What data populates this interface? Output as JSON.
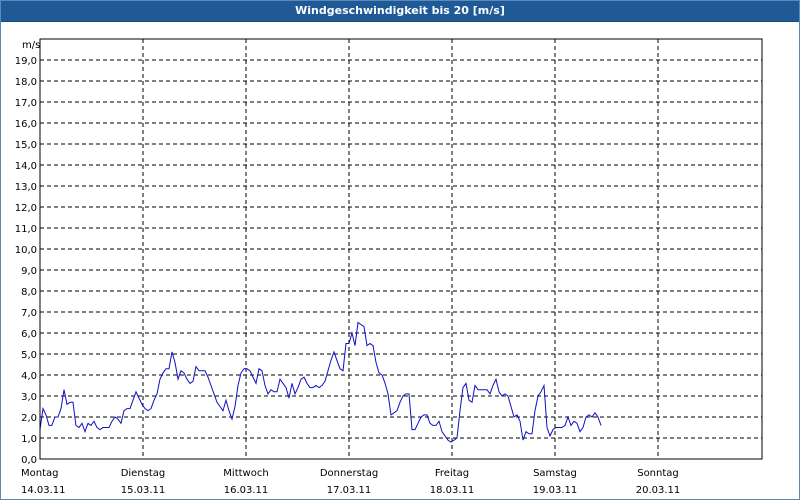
{
  "window": {
    "title": "Windgeschwindigkeit bis 20 [m/s]"
  },
  "chart_data": {
    "type": "line",
    "title": "Windgeschwindigkeit bis 20 [m/s]",
    "ylabel": "m/s",
    "xlabel": "",
    "ylim": [
      0,
      20
    ],
    "y_ticks": [
      "0,0",
      "1,0",
      "2,0",
      "3,0",
      "4,0",
      "5,0",
      "6,0",
      "7,0",
      "8,0",
      "9,0",
      "10,0",
      "11,0",
      "12,0",
      "13,0",
      "14,0",
      "15,0",
      "16,0",
      "17,0",
      "18,0",
      "19,0"
    ],
    "x_labels": [
      {
        "day": "Montag",
        "date": "14.03.11"
      },
      {
        "day": "Dienstag",
        "date": "15.03.11"
      },
      {
        "day": "Mittwoch",
        "date": "16.03.11"
      },
      {
        "day": "Donnerstag",
        "date": "17.03.11"
      },
      {
        "day": "Freitag",
        "date": "18.03.11"
      },
      {
        "day": "Samstag",
        "date": "19.03.11"
      },
      {
        "day": "Sonntag",
        "date": "20.03.11"
      }
    ],
    "xlim_days": [
      0,
      7
    ],
    "grid": true,
    "line_color": "#1010c0",
    "series": [
      {
        "values": [
          [
            0.0,
            1.4
          ],
          [
            0.029,
            2.4
          ],
          [
            0.058,
            2.1
          ],
          [
            0.087,
            1.6
          ],
          [
            0.116,
            1.6
          ],
          [
            0.145,
            2.0
          ],
          [
            0.175,
            2.0
          ],
          [
            0.204,
            2.4
          ],
          [
            0.233,
            3.3
          ],
          [
            0.262,
            2.6
          ],
          [
            0.291,
            2.7
          ],
          [
            0.32,
            2.7
          ],
          [
            0.349,
            1.6
          ],
          [
            0.379,
            1.5
          ],
          [
            0.408,
            1.7
          ],
          [
            0.437,
            1.3
          ],
          [
            0.466,
            1.7
          ],
          [
            0.495,
            1.6
          ],
          [
            0.524,
            1.8
          ],
          [
            0.553,
            1.5
          ],
          [
            0.583,
            1.4
          ],
          [
            0.612,
            1.5
          ],
          [
            0.641,
            1.5
          ],
          [
            0.67,
            1.5
          ],
          [
            0.699,
            1.8
          ],
          [
            0.728,
            2.0
          ],
          [
            0.757,
            1.9
          ],
          [
            0.786,
            1.7
          ],
          [
            0.816,
            2.3
          ],
          [
            0.845,
            2.4
          ],
          [
            0.874,
            2.4
          ],
          [
            0.903,
            2.8
          ],
          [
            0.932,
            3.2
          ],
          [
            0.961,
            2.9
          ],
          [
            0.99,
            2.6
          ],
          [
            1.019,
            2.4
          ],
          [
            1.049,
            2.3
          ],
          [
            1.078,
            2.4
          ],
          [
            1.107,
            2.8
          ],
          [
            1.136,
            3.1
          ],
          [
            1.165,
            3.8
          ],
          [
            1.194,
            4.1
          ],
          [
            1.223,
            4.3
          ],
          [
            1.252,
            4.3
          ],
          [
            1.282,
            5.1
          ],
          [
            1.311,
            4.6
          ],
          [
            1.34,
            3.8
          ],
          [
            1.369,
            4.2
          ],
          [
            1.398,
            4.1
          ],
          [
            1.427,
            3.8
          ],
          [
            1.456,
            3.6
          ],
          [
            1.485,
            3.7
          ],
          [
            1.515,
            4.4
          ],
          [
            1.544,
            4.2
          ],
          [
            1.573,
            4.2
          ],
          [
            1.602,
            4.2
          ],
          [
            1.631,
            3.9
          ],
          [
            1.66,
            3.5
          ],
          [
            1.689,
            3.1
          ],
          [
            1.718,
            2.7
          ],
          [
            1.748,
            2.5
          ],
          [
            1.777,
            2.3
          ],
          [
            1.806,
            2.8
          ],
          [
            1.835,
            2.3
          ],
          [
            1.864,
            1.9
          ],
          [
            1.893,
            2.5
          ],
          [
            1.922,
            3.5
          ],
          [
            1.951,
            4.1
          ],
          [
            1.981,
            4.3
          ],
          [
            2.01,
            4.3
          ],
          [
            2.039,
            4.2
          ],
          [
            2.068,
            3.9
          ],
          [
            2.097,
            3.6
          ],
          [
            2.126,
            4.3
          ],
          [
            2.155,
            4.2
          ],
          [
            2.184,
            3.5
          ],
          [
            2.214,
            3.1
          ],
          [
            2.243,
            3.3
          ],
          [
            2.272,
            3.2
          ],
          [
            2.301,
            3.2
          ],
          [
            2.33,
            3.8
          ],
          [
            2.359,
            3.6
          ],
          [
            2.388,
            3.4
          ],
          [
            2.417,
            2.9
          ],
          [
            2.447,
            3.6
          ],
          [
            2.476,
            3.1
          ],
          [
            2.505,
            3.4
          ],
          [
            2.534,
            3.8
          ],
          [
            2.563,
            3.9
          ],
          [
            2.592,
            3.6
          ],
          [
            2.621,
            3.4
          ],
          [
            2.65,
            3.4
          ],
          [
            2.68,
            3.5
          ],
          [
            2.709,
            3.4
          ],
          [
            2.738,
            3.5
          ],
          [
            2.767,
            3.7
          ],
          [
            2.796,
            4.2
          ],
          [
            2.825,
            4.7
          ],
          [
            2.854,
            5.1
          ],
          [
            2.883,
            4.7
          ],
          [
            2.913,
            4.3
          ],
          [
            2.942,
            4.2
          ],
          [
            2.971,
            5.5
          ],
          [
            3.0,
            5.5
          ],
          [
            3.029,
            6.0
          ],
          [
            3.058,
            5.4
          ],
          [
            3.087,
            6.5
          ],
          [
            3.117,
            6.4
          ],
          [
            3.146,
            6.3
          ],
          [
            3.175,
            5.4
          ],
          [
            3.204,
            5.5
          ],
          [
            3.233,
            5.4
          ],
          [
            3.262,
            4.6
          ],
          [
            3.291,
            4.1
          ],
          [
            3.32,
            4.0
          ],
          [
            3.35,
            3.6
          ],
          [
            3.379,
            3.1
          ],
          [
            3.408,
            2.1
          ],
          [
            3.437,
            2.2
          ],
          [
            3.466,
            2.3
          ],
          [
            3.495,
            2.7
          ],
          [
            3.524,
            3.0
          ],
          [
            3.553,
            3.1
          ],
          [
            3.583,
            3.1
          ],
          [
            3.612,
            1.4
          ],
          [
            3.641,
            1.4
          ],
          [
            3.67,
            1.7
          ],
          [
            3.699,
            2.0
          ],
          [
            3.728,
            2.1
          ],
          [
            3.757,
            2.1
          ],
          [
            3.786,
            1.7
          ],
          [
            3.816,
            1.6
          ],
          [
            3.845,
            1.6
          ],
          [
            3.874,
            1.8
          ],
          [
            3.903,
            1.3
          ],
          [
            3.932,
            1.1
          ],
          [
            3.961,
            0.9
          ],
          [
            3.99,
            0.8
          ],
          [
            4.019,
            0.9
          ],
          [
            4.049,
            1.0
          ],
          [
            4.078,
            2.3
          ],
          [
            4.107,
            3.4
          ],
          [
            4.136,
            3.6
          ],
          [
            4.165,
            2.8
          ],
          [
            4.194,
            2.7
          ],
          [
            4.223,
            3.5
          ],
          [
            4.252,
            3.3
          ],
          [
            4.282,
            3.3
          ],
          [
            4.311,
            3.3
          ],
          [
            4.34,
            3.3
          ],
          [
            4.369,
            3.1
          ],
          [
            4.398,
            3.5
          ],
          [
            4.427,
            3.8
          ],
          [
            4.456,
            3.2
          ],
          [
            4.485,
            3.0
          ],
          [
            4.515,
            3.1
          ],
          [
            4.544,
            3.0
          ],
          [
            4.573,
            2.5
          ],
          [
            4.602,
            2.0
          ],
          [
            4.631,
            2.1
          ],
          [
            4.66,
            1.8
          ],
          [
            4.689,
            0.9
          ],
          [
            4.718,
            1.3
          ],
          [
            4.748,
            1.2
          ],
          [
            4.777,
            1.2
          ],
          [
            4.806,
            2.3
          ],
          [
            4.835,
            3.0
          ],
          [
            4.864,
            3.2
          ],
          [
            4.893,
            3.5
          ],
          [
            4.922,
            1.5
          ],
          [
            4.951,
            1.1
          ],
          [
            4.981,
            1.4
          ],
          [
            5.01,
            1.5
          ],
          [
            5.039,
            1.5
          ],
          [
            5.068,
            1.5
          ],
          [
            5.097,
            1.6
          ],
          [
            5.126,
            2.0
          ],
          [
            5.155,
            1.6
          ],
          [
            5.184,
            1.8
          ],
          [
            5.214,
            1.7
          ],
          [
            5.243,
            1.3
          ],
          [
            5.272,
            1.5
          ],
          [
            5.301,
            2.0
          ],
          [
            5.33,
            2.1
          ],
          [
            5.359,
            2.0
          ],
          [
            5.388,
            2.2
          ],
          [
            5.417,
            2.0
          ],
          [
            5.447,
            1.6
          ]
        ]
      }
    ]
  }
}
